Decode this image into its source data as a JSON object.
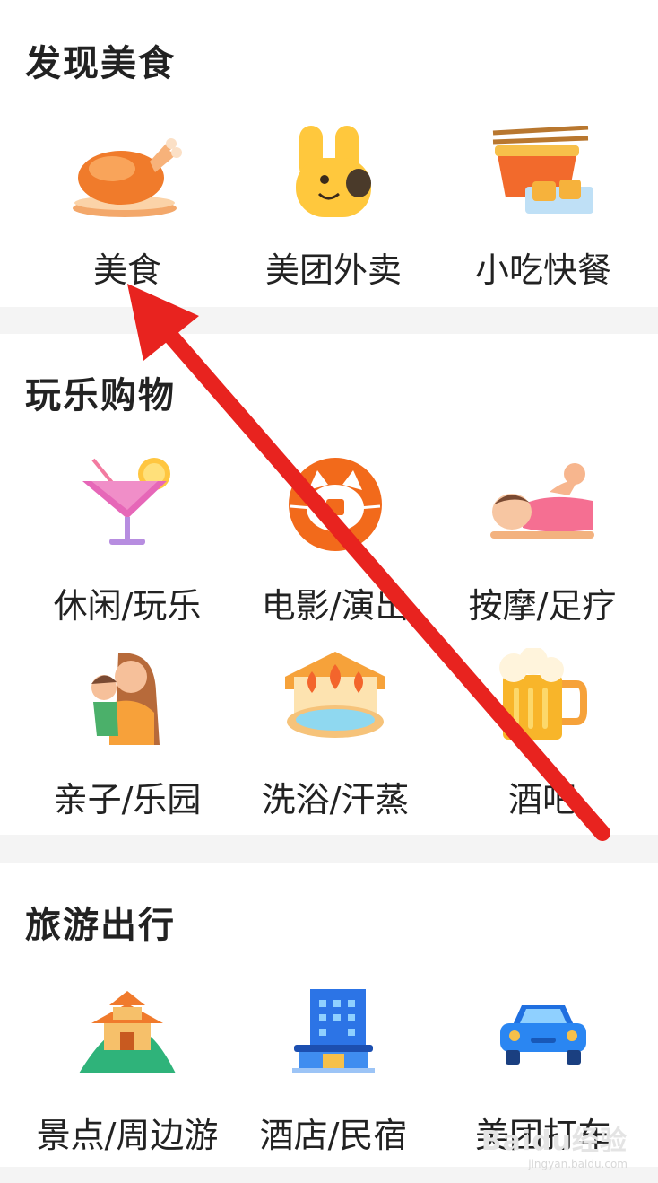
{
  "sections": [
    {
      "title": "发现美食",
      "items": [
        {
          "label": "美食",
          "icon": "roast-chicken-icon"
        },
        {
          "label": "美团外卖",
          "icon": "kangaroo-icon"
        },
        {
          "label": "小吃快餐",
          "icon": "noodle-bowl-icon"
        }
      ]
    },
    {
      "title": "玩乐购物",
      "items": [
        {
          "label": "休闲/玩乐",
          "icon": "cocktail-icon"
        },
        {
          "label": "电影/演出",
          "icon": "cat-film-icon"
        },
        {
          "label": "按摩/足疗",
          "icon": "massage-icon"
        },
        {
          "label": "亲子/乐园",
          "icon": "mother-child-icon"
        },
        {
          "label": "洗浴/汗蒸",
          "icon": "hot-spring-icon"
        },
        {
          "label": "酒吧",
          "icon": "beer-mug-icon"
        }
      ]
    },
    {
      "title": "旅游出行",
      "items": [
        {
          "label": "景点/周边游",
          "icon": "pagoda-icon"
        },
        {
          "label": "酒店/民宿",
          "icon": "hotel-building-icon"
        },
        {
          "label": "美团打车",
          "icon": "taxi-car-icon"
        }
      ]
    }
  ],
  "watermark": {
    "brand": "Baidu经验",
    "url": "jingyan.baidu.com"
  },
  "colors": {
    "arrow": "#e8231f",
    "background": "#f4f4f4",
    "text": "#222222"
  }
}
